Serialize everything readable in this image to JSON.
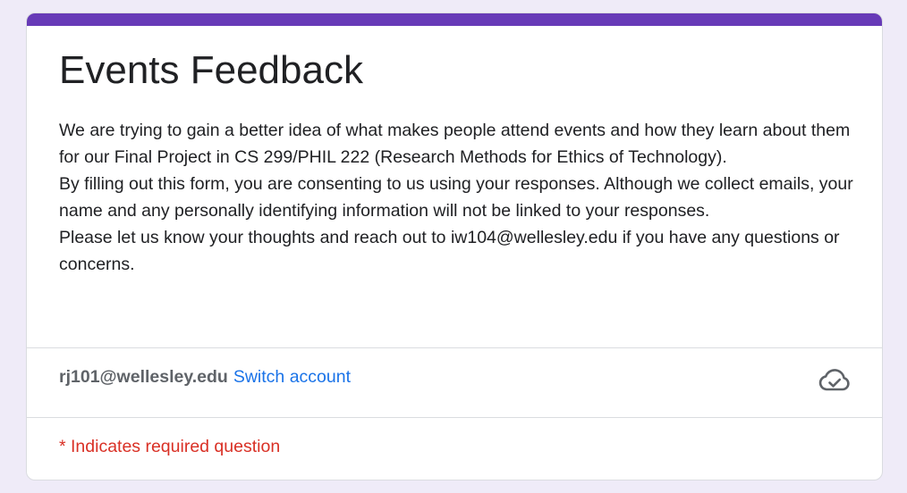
{
  "form": {
    "title": "Events Feedback",
    "description": [
      "We are trying to gain a better idea of what makes people attend events and how they learn about them for our Final Project in CS 299/PHIL 222 (Research Methods for Ethics of Technology).",
      "By filling out this form, you are consenting to us using your responses. Although we collect emails, your name and any personally identifying information will not be linked to your responses.",
      "Please let us know your thoughts and reach out to iw104@wellesley.edu if you have any questions or concerns."
    ],
    "account_email": "rj101@wellesley.edu",
    "switch_account_label": "Switch account",
    "saved_icon": "cloud-check-icon",
    "required_note": "* Indicates required question"
  },
  "colors": {
    "accent": "#673ab7",
    "link": "#1a73e8",
    "required": "#d93025",
    "background": "#efebf8"
  }
}
